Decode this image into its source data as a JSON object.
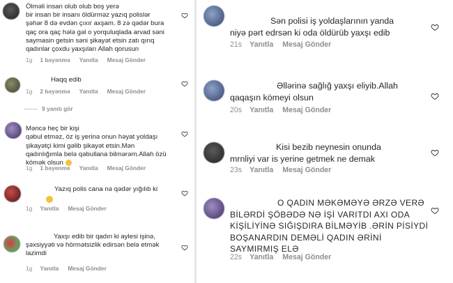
{
  "left": {
    "comments": [
      {
        "text": "Ölməli insan olub olub boş yerə\nbir insan bir insanı öldürməz yazıq polislər\nşəhər 8 də evdən çıxır axşam. 8 zə qədər bura\nqaç ora qaç hələ gəl o yorquluqlada arvad səni\nsaymasin getsin səni şikayət etsin zatı qırıq\nqadınlar çoxdu yaxşıları Allah qorusun",
        "time": "1g",
        "likes": "1 bəyənmə",
        "reply": "Yanıtla",
        "send": "Mesaj Gönder"
      },
      {
        "text": "Haqq edib",
        "time": "1g",
        "likes": "2 bəyənmə",
        "reply": "Yanıtla",
        "send": "Mesaj Gönder",
        "view_replies": "9 yanıtı gör"
      },
      {
        "text": "Məncə heç bir kişi\nqəbul etməz, öz iş yerinə onun həyat yoldaşı\nşikayətçi kimi gəlib şikayət etsin.Mən\nqadınlığımla belə qəbullana bilmərəm.Allah özü\nkömək olsun",
        "time": "1g",
        "likes": "1 bəyenme",
        "reply": "Yanıtla",
        "send": "Mesaj Gönder"
      },
      {
        "text": "Yazıq polis cana nə qədər yığılıb ki",
        "time": "1g",
        "reply": "Yanıtla",
        "send": "Mesaj Gönder"
      },
      {
        "text": "Yaxşı edib bir qadın ki aylesi işinə,\nşəxsiyyəti və hörmətsizlik edirsən belə etmək\nlazimdi",
        "time": "1g",
        "reply": "Yanıtla",
        "send": "Mesaj Gönder"
      }
    ]
  },
  "right": {
    "comments": [
      {
        "text": "Sən polisi iş yoldaşlarının yanda\nniyə pərt edrsən ki oda öldürüb yaxşı edib",
        "time": "21s",
        "reply": "Yanıtla",
        "send": "Mesaj Gönder"
      },
      {
        "text": "Əllərinə sağlığ yaxşı eliyib.Allah\nqaqaşın kömeyi olsun",
        "time": "20s",
        "reply": "Yanıtla",
        "send": "Mesaj Gönder"
      },
      {
        "text": "Kisi bezib neynesin onunda\nmrnliyi var is yerine getmek ne demak",
        "time": "23s",
        "reply": "Yanıtla",
        "send": "Mesaj Gönder"
      },
      {
        "text": "O QADIN MƏKƏMƏYƏ ƏRZƏ VERƏ\nBİLƏRDİ ŞÖBƏDƏ NƏ İŞİ VARITDI AXI ODA\nKİŞİLİYİNƏ SIĞIŞDIRA BİLMƏYİB .ƏRİN PİSİYDİ\nBOŞANARDIN DEMƏLİ QADIN ƏRİNİ\nSAYMIRMIŞ ELƏ",
        "time": "22s",
        "reply": "Yanıtla",
        "send": "Mesaj Gönder"
      }
    ]
  }
}
